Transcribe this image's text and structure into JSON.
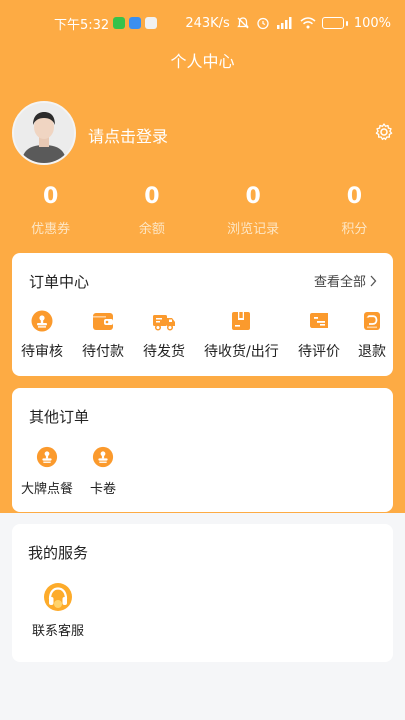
{
  "status_bar": {
    "time": "下午5:32",
    "network_speed": "243K/s",
    "battery_percent": "100%"
  },
  "header": {
    "title": "个人中心"
  },
  "profile": {
    "login_prompt": "请点击登录"
  },
  "stats": [
    {
      "value": "0",
      "label": "优惠券"
    },
    {
      "value": "0",
      "label": "余额"
    },
    {
      "value": "0",
      "label": "浏览记录"
    },
    {
      "value": "0",
      "label": "积分"
    }
  ],
  "order_center": {
    "title": "订单中心",
    "view_all": "查看全部",
    "items": [
      {
        "label": "待审核",
        "icon": "pending-review-icon"
      },
      {
        "label": "待付款",
        "icon": "wallet-icon"
      },
      {
        "label": "待发货",
        "icon": "truck-icon"
      },
      {
        "label": "待收货/出行",
        "icon": "package-icon"
      },
      {
        "label": "待评价",
        "icon": "review-card-icon"
      },
      {
        "label": "退款",
        "icon": "refund-icon"
      }
    ]
  },
  "other_orders": {
    "title": "其他订单",
    "items": [
      {
        "label": "大牌点餐",
        "icon": "stamp-icon"
      },
      {
        "label": "卡卷",
        "icon": "stamp-icon"
      }
    ]
  },
  "services": {
    "title": "我的服务",
    "items": [
      {
        "label": "联系客服",
        "icon": "headset-icon"
      }
    ]
  },
  "colors": {
    "brand": "#fdab44",
    "icon": "#fb9a2d",
    "background": "#f5f6f8"
  }
}
